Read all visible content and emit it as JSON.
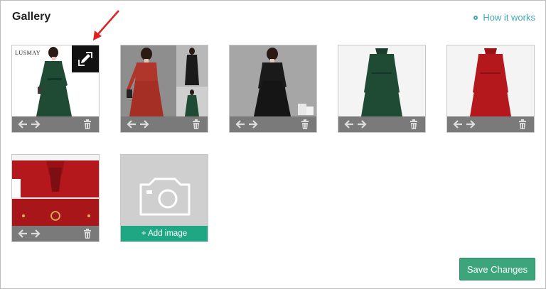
{
  "header": {
    "title": "Gallery",
    "help_link": "How it works"
  },
  "gallery": {
    "images": [
      {
        "label": "green-dress-model-front",
        "brand_text": "LUSMAY",
        "dress_color": "#1f4b35",
        "has_edit_overlay": true
      },
      {
        "label": "red-dress-model-collage",
        "dress_color": "#b0352a"
      },
      {
        "label": "black-dress-model",
        "dress_color": "#1a1a1a"
      },
      {
        "label": "green-dress-mannequin",
        "dress_color": "#1f4b35"
      },
      {
        "label": "red-dress-mannequin",
        "dress_color": "#b5181c"
      },
      {
        "label": "red-dress-collar-detail",
        "dress_color": "#b5181c"
      }
    ],
    "add_label": "+ Add image"
  },
  "footer": {
    "save_label": "Save Changes"
  },
  "colors": {
    "accent": "#3fa9b5",
    "add_green": "#1fa784",
    "save_green": "#3da57c",
    "toolbar_gray": "#7a7a7a",
    "pointer_red": "#e02020"
  },
  "icons": {
    "edit": "pencil-edit-icon",
    "move_left": "arrow-left-icon",
    "move_right": "arrow-right-icon",
    "delete": "trash-icon",
    "add": "camera-icon",
    "help": "circle-dot-icon"
  }
}
